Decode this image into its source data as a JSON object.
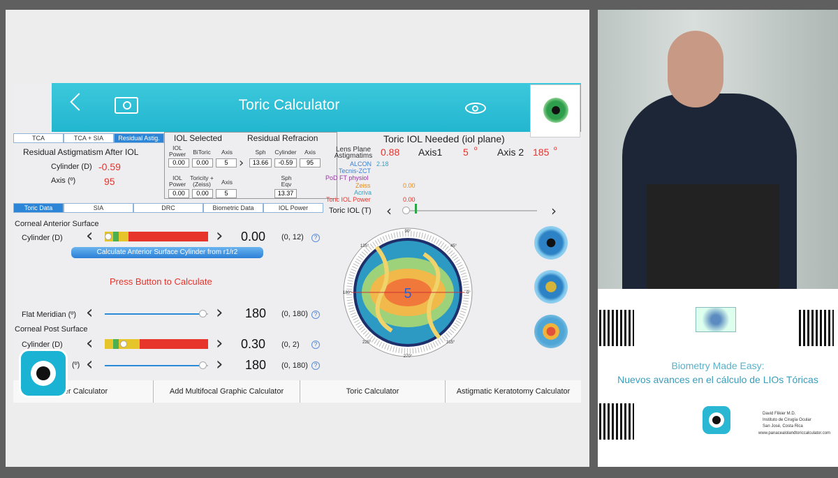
{
  "header": {
    "title": "Toric Calculator"
  },
  "modes": {
    "tca": "TCA",
    "tca_sia": "TCA + SIA",
    "residual": "Residual Astig."
  },
  "residual": {
    "title": "Residual Astigmatism After IOL",
    "cyl_label": "Cylinder (D)",
    "cyl_value": "-0.59",
    "axis_label": "Axis (º)",
    "axis_value": "95"
  },
  "iol_selected": {
    "title": "IOL Selected",
    "col1": "IOL Power",
    "col2": "BiToric",
    "col3": "Axis",
    "v1": "0.00",
    "v2": "0.00",
    "v3": "5",
    "col4": "IOL Power",
    "col5": "Toricity + (Zeiss)",
    "col6": "Axis",
    "v4": "0.00",
    "v5": "0.00",
    "v6": "5"
  },
  "residual_refraction": {
    "title": "Residual Refracion",
    "sph": "Sph",
    "cyl": "Cylinder",
    "axis": "Axis",
    "v_sph": "13.66",
    "v_cyl": "-0.59",
    "v_axis": "95",
    "eqv_label": "Sph Eqv",
    "eqv": "13.37"
  },
  "toric_needed": {
    "title": "Toric IOL Needed (iol plane)",
    "lens_plane": "Lens Plane Astigmatims",
    "value": "0.88",
    "axis1_label": "Axis1",
    "axis1": "5",
    "deg": "º",
    "axis2_label": "Axis 2",
    "axis2": "185",
    "alcon": "ALCON",
    "alcon_val": "2.18",
    "tecnis": "Tecnis-ZCT",
    "pod": "PoD FT physiol",
    "zeiss": "Zeiss",
    "zeiss_val": "0.00",
    "acriva": "Acriva",
    "iolpower": "Toric IOL Power",
    "iolpower_val": "0.00",
    "toric_iol": "Toric IOL (T)"
  },
  "tabs": {
    "t1": "Toric Data",
    "t2": "SIA",
    "t3": "DRC",
    "t4": "Biometric Data",
    "t5": "IOL Power"
  },
  "anterior": {
    "title": "Corneal Anterior Surface",
    "cyl_label": "Cylinder (D)",
    "value": "0.00",
    "range": "(0, 12)",
    "calc_button": "Calculate Anterior Surface Cylinder from r1/r2"
  },
  "press": "Press Button to Calculate",
  "flat": {
    "label": "Flat Meridian (º)",
    "value": "180",
    "range": "(0, 180)"
  },
  "post": {
    "title": "Corneal Post Surface",
    "cyl_label": "Cylinder (D)",
    "value": "0.30",
    "range": "(0, 2)",
    "axis_label": "(º)",
    "axis_value": "180",
    "axis_range": "(0, 180)"
  },
  "q": "?",
  "dial": {
    "center": "5",
    "a90": "90°",
    "a135": "135°",
    "a45": "45°",
    "a180": "180°",
    "a0": "0°",
    "a225": "225°",
    "a315": "315°",
    "a270": "270°"
  },
  "bottom_tabs": {
    "b1": "wer Calculator",
    "b2": "Add Multifocal Graphic Calculator",
    "b3": "Toric Calculator",
    "b4": "Astigmatic Keratotomy Calculator"
  },
  "side": {
    "line1": "Biometry Made Easy:",
    "line2": "Nuevos avances en el cálculo de LIOs Tóricas",
    "author": "David Flikier M.D.",
    "inst": "Instituto de Cirugía Ocular",
    "city": "San José, Costa Rica",
    "web": "www.panacealolandtoriccalculator.com"
  },
  "colors": {
    "accent": "#22b6cf",
    "red": "#e4342c",
    "blue": "#2c85d6"
  }
}
